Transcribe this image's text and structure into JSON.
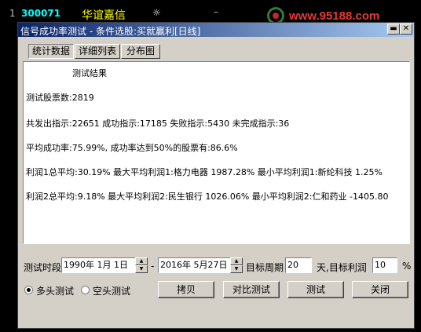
{
  "background": {
    "row_index": "1",
    "stock_code": "300071",
    "stock_name": "华谊嘉信",
    "star": "☼",
    "dash": "–",
    "watermark": "www.95188.com"
  },
  "dialog": {
    "title": "信号成功率测试 - 条件选股:买就赢利[日线]",
    "close_glyph": "✕",
    "min_glyph": "▬",
    "tabs": [
      {
        "label": "统计数据",
        "active": true
      },
      {
        "label": "详细列表",
        "active": false
      },
      {
        "label": "分布图",
        "active": false
      }
    ],
    "results": {
      "heading": "测试结果",
      "lines": [
        "测试股票数:2819",
        "共发出指示:22651 成功指示:17185 失败指示:5430 未完成指示:36",
        "平均成功率:75.99%, 成功率达到50%的股票有:86.6%",
        "利润1总平均:30.19% 最大平均利润1:格力电器 1987.28% 最小平均利润1:新纶科技 1.25%",
        "利润2总平均:9.18% 最大平均利润2:民生银行 1026.06% 最小平均利润2:仁和药业 -1405.80"
      ]
    },
    "controls": {
      "period_label": "测试时段",
      "start_date": "1990年 1月 1日",
      "separator": "-",
      "end_date": "2016年 5月27日",
      "target_period_label": "目标周期",
      "target_period_value": "20",
      "target_profit_label": "天,目标利润",
      "target_profit_value": "10",
      "percent_label": "%",
      "radio_long": "多头测试",
      "radio_short": "空头测试"
    },
    "buttons": {
      "copy": "拷贝",
      "compare": "对比测试",
      "test": "测试",
      "close": "关闭"
    }
  }
}
